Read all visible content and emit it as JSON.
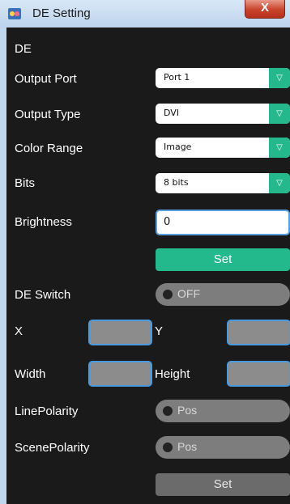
{
  "window": {
    "title": "DE Setting",
    "close_label": "X"
  },
  "section": {
    "title": "DE"
  },
  "output_port": {
    "label": "Output Port",
    "value": "Port 1"
  },
  "output_type": {
    "label": "Output Type",
    "value": "DVI"
  },
  "color_range": {
    "label": "Color Range",
    "value": "Image"
  },
  "bits": {
    "label": "Bits",
    "value": "8 bits"
  },
  "brightness": {
    "label": "Brightness",
    "value": "0"
  },
  "set_button_1": {
    "label": "Set"
  },
  "de_switch": {
    "label": "DE Switch",
    "state": "OFF"
  },
  "x": {
    "label": "X",
    "value": ""
  },
  "y": {
    "label": "Y",
    "value": ""
  },
  "width": {
    "label": "Width",
    "value": ""
  },
  "height": {
    "label": "Height",
    "value": ""
  },
  "line_polarity": {
    "label": "LinePolarity",
    "state": "Pos"
  },
  "scene_polarity": {
    "label": "ScenePolarity",
    "state": "Pos"
  },
  "set_button_2": {
    "label": "Set"
  },
  "icons": {
    "dropdown_arrow": "chevron-down-icon",
    "app": "app-logo-icon",
    "close": "close-icon"
  },
  "colors": {
    "accent": "#24b98c",
    "panel_bg": "#1a1a1a",
    "titlebar": "#bcd3ec",
    "close": "#c9422b"
  }
}
